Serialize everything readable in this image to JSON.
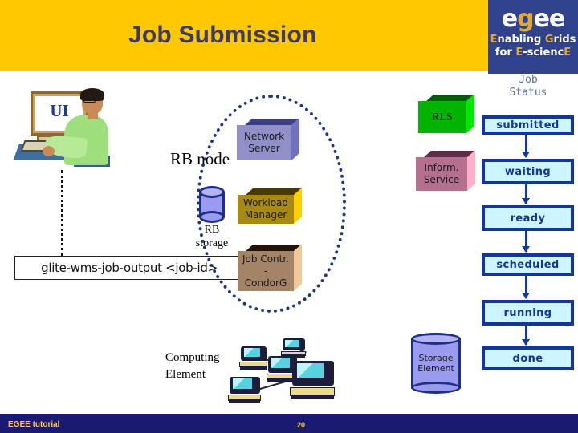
{
  "header": {
    "title": "Job Submission",
    "logo": {
      "word_part1": "e",
      "word_part2": "g",
      "word_part3": "ee",
      "line2_a": "E",
      "line2_b": "nabling ",
      "line2_c": "G",
      "line2_d": "rids",
      "line3_a": "for ",
      "line3_b": "E",
      "line3_c": "-scienc",
      "line3_d": "E"
    }
  },
  "footer": {
    "left_label": "EGEE tutorial",
    "page_number": "20"
  },
  "diagram": {
    "ui_screen_label": "UI",
    "command": "glite-wms-job-output <job-id>",
    "rb_node_label": "RB node",
    "rb_storage_line1": "RB",
    "rb_storage_line2": "storage",
    "computing_element_line1": "Computing",
    "computing_element_line2": "Element",
    "storage_element_line1": "Storage",
    "storage_element_line2": "Element",
    "boxes": [
      {
        "id": "network-server",
        "line1": "Network",
        "line2": "Server",
        "fill": "#8f90c8"
      },
      {
        "id": "workload-manager",
        "line1": "Workload",
        "line2": "Manager",
        "fill": "#a88a10"
      },
      {
        "id": "job-controller",
        "line1": "Job Contr.",
        "line2": "-",
        "line3": "CondorG",
        "fill": "#a38467"
      },
      {
        "id": "rls",
        "line1": "RLS",
        "line2": "",
        "fill": "#00b400"
      },
      {
        "id": "inform-service",
        "line1": "Inform.",
        "line2": "Service",
        "fill": "#b5708f"
      }
    ]
  },
  "job_status": {
    "title_line1": "Job",
    "title_line2": "Status",
    "states": [
      {
        "id": "submitted",
        "label": "submitted"
      },
      {
        "id": "waiting",
        "label": "waiting"
      },
      {
        "id": "ready",
        "label": "ready"
      },
      {
        "id": "scheduled",
        "label": "scheduled"
      },
      {
        "id": "running",
        "label": "running"
      },
      {
        "id": "done",
        "label": "done"
      }
    ],
    "box_fill": "#ccf5fd",
    "box_border": "#13369c"
  }
}
